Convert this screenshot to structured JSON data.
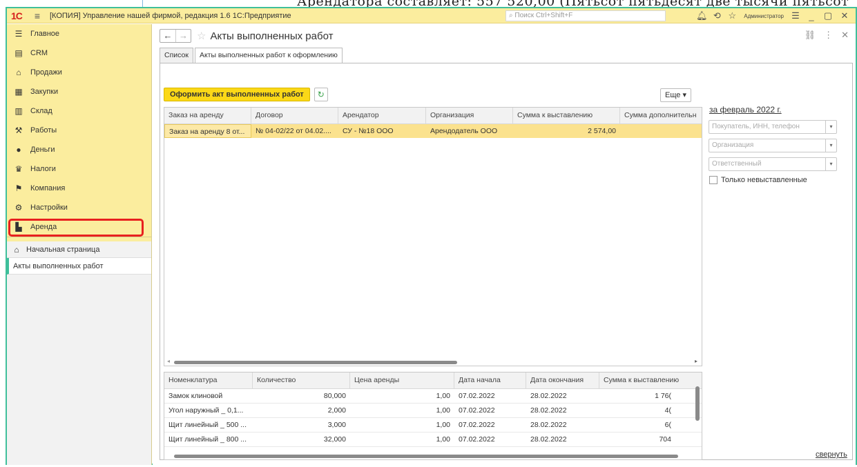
{
  "background_doc": {
    "text": "Арендатора составляет: 557 520,00 (Пятьсот пятьдесят две тысячи пятьсот"
  },
  "titlebar": {
    "logo": "1С",
    "title": "[КОПИЯ] Управление нашей фирмой, редакция 1.6 1С:Предприятие",
    "search_placeholder": "Поиск Ctrl+Shift+F",
    "user": "Администратор"
  },
  "sidebar": {
    "items": [
      {
        "label": "Главное",
        "icon": "menu-icon"
      },
      {
        "label": "CRM",
        "icon": "crm-icon"
      },
      {
        "label": "Продажи",
        "icon": "sales-icon"
      },
      {
        "label": "Закупки",
        "icon": "purchases-icon"
      },
      {
        "label": "Склад",
        "icon": "warehouse-icon"
      },
      {
        "label": "Работы",
        "icon": "works-icon"
      },
      {
        "label": "Деньги",
        "icon": "money-icon"
      },
      {
        "label": "Налоги",
        "icon": "taxes-icon"
      },
      {
        "label": "Компания",
        "icon": "company-icon"
      },
      {
        "label": "Настройки",
        "icon": "gear-icon"
      },
      {
        "label": "Аренда",
        "icon": "rent-icon"
      }
    ],
    "home": "Начальная страница",
    "open_form": "Акты выполненных работ"
  },
  "form": {
    "title": "Акты выполненных работ",
    "tabs": [
      "Список",
      "Акты выполненных работ к оформлению"
    ],
    "create_button": "Оформить акт выполненных работ",
    "more_button": "Еще ▾",
    "grid1": {
      "columns": [
        "Заказ на аренду",
        "Договор",
        "Арендатор",
        "Организация",
        "Сумма к выставлению",
        "Сумма дополнительн"
      ],
      "rows": [
        [
          "Заказ на аренду 8 от...",
          "№ 04-02/22 от 04.02....",
          "СУ - №18 ООО",
          "Арендодатель ООО",
          "2 574,00",
          ""
        ]
      ]
    },
    "grid2": {
      "columns": [
        "Номенклатура",
        "Количество",
        "Цена аренды",
        "Дата начала",
        "Дата окончания",
        "Сумма к выставлению"
      ],
      "rows": [
        [
          "Замок клиновой",
          "80,000",
          "1,00",
          "07.02.2022",
          "28.02.2022",
          "1 76("
        ],
        [
          "Угол наружный _ 0,1...",
          "2,000",
          "1,00",
          "07.02.2022",
          "28.02.2022",
          "4("
        ],
        [
          "Щит линейный _ 500 ...",
          "3,000",
          "1,00",
          "07.02.2022",
          "28.02.2022",
          "6("
        ],
        [
          "Щит линейный _ 800 ...",
          "32,000",
          "1,00",
          "07.02.2022",
          "28.02.2022",
          "704"
        ]
      ]
    },
    "filters": {
      "period": "за февраль 2022 г.",
      "buyer_placeholder": "Покупатель, ИНН, телефон",
      "org_placeholder": "Организация",
      "responsible_placeholder": "Ответственный",
      "only_unbilled": "Только невыставленные"
    },
    "collapse_link": "свернуть"
  }
}
